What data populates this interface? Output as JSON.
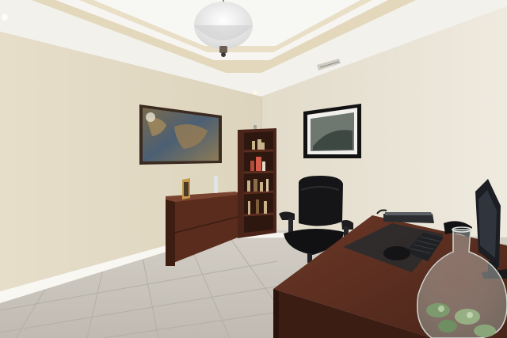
{
  "scene": {
    "palette": {
      "wall_left": "#e4dcc7",
      "wall_right": "#ebe5d6",
      "ceiling": "#f3f2ee",
      "tray_band": "#e2d6b8",
      "floor": "#c9c4bc",
      "floor_grout": "#b2ada4",
      "wood_dark": "#4e2a1c",
      "wood_mid": "#6a3626",
      "chair": "#17171a",
      "monitor": "#1e2026",
      "baseboard": "#f7f6f1"
    },
    "icons": {
      "pendant_light": "pendant-light-icon",
      "ceiling_vent": "ceiling-vent-icon"
    }
  }
}
